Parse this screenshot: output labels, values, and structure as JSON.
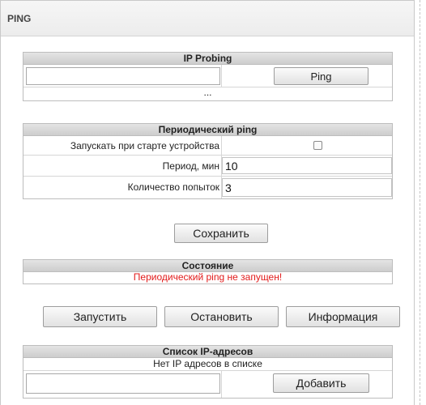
{
  "page": {
    "title": "PING"
  },
  "ip_probing": {
    "header": "IP Probing",
    "address_value": "",
    "ping_button": "Ping",
    "result": "..."
  },
  "periodic": {
    "header": "Периодический ping",
    "start_on_boot_label": "Запускать при старте устройства",
    "start_on_boot_checked": false,
    "period_label": "Период, мин",
    "period_value": "10",
    "attempts_label": "Количество попыток",
    "attempts_value": "3"
  },
  "save_button": "Сохранить",
  "status": {
    "header": "Состояние",
    "text": "Периодический ping не запущен!",
    "text_color": "#e21b1b"
  },
  "actions": {
    "start": "Запустить",
    "stop": "Остановить",
    "info": "Информация"
  },
  "ip_list": {
    "header": "Список IP-адресов",
    "empty_text": "Нет IP адресов в списке",
    "new_address_value": "",
    "add_button": "Добавить"
  }
}
